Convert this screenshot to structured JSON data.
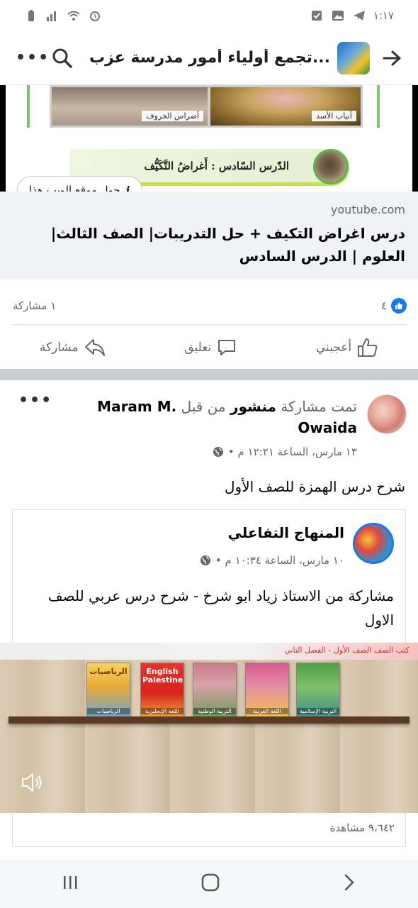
{
  "status_bar": {
    "time": "١:١٧"
  },
  "header": {
    "title": "تجمع أولياء أمور مدرسة عزب..."
  },
  "link_preview": {
    "caption_left": "أضراس الخروف",
    "caption_right": "أنياب الأسد",
    "lesson_banner": "الدّرس السّادس : أَغراضُ التَّكَيُّف",
    "about_site": "حول موقع الويب هذا",
    "domain": "youtube.com",
    "title": "درس اغراض التكيف + حل التدريبات| الصف الثالث| العلوم | الدرس السادس"
  },
  "reactions": {
    "likes_count": "٤",
    "shares": "١ مشاركة"
  },
  "actions": {
    "like": "أعجبني",
    "comment": "تعليق",
    "share": "مشاركة"
  },
  "post2": {
    "prefix": "تمت مشاركة",
    "post_word": "منشور",
    "by": "من قبل",
    "author": "Maram M. Owaida",
    "meta": "١٣ مارس، الساعة ١٢:٢١ م •",
    "text": "شرح درس الهمزة للصف الأول"
  },
  "shared_post": {
    "page_name": "المنهاج التفاعلي",
    "meta": "١٠ مارس، الساعة ١٠:٣٤ م •",
    "text": "مشاركة من الاستاذ زياد ابو شرخ - شرح درس عربي للصف الاول",
    "video_header": "كتب الصف الصف الأول - الفصل الثاني",
    "books": [
      {
        "title": "الرياضيات",
        "label": "الرياضيات"
      },
      {
        "title": "English Palestine",
        "label": "اللغة الإنجليزية"
      },
      {
        "title": "",
        "label": "التربية الوطنية"
      },
      {
        "title": "",
        "label": "اللغة العربية"
      },
      {
        "title": "",
        "label": "التربية الإسلامية"
      }
    ],
    "views": "٩،٦٤٢ مشاهدة"
  }
}
